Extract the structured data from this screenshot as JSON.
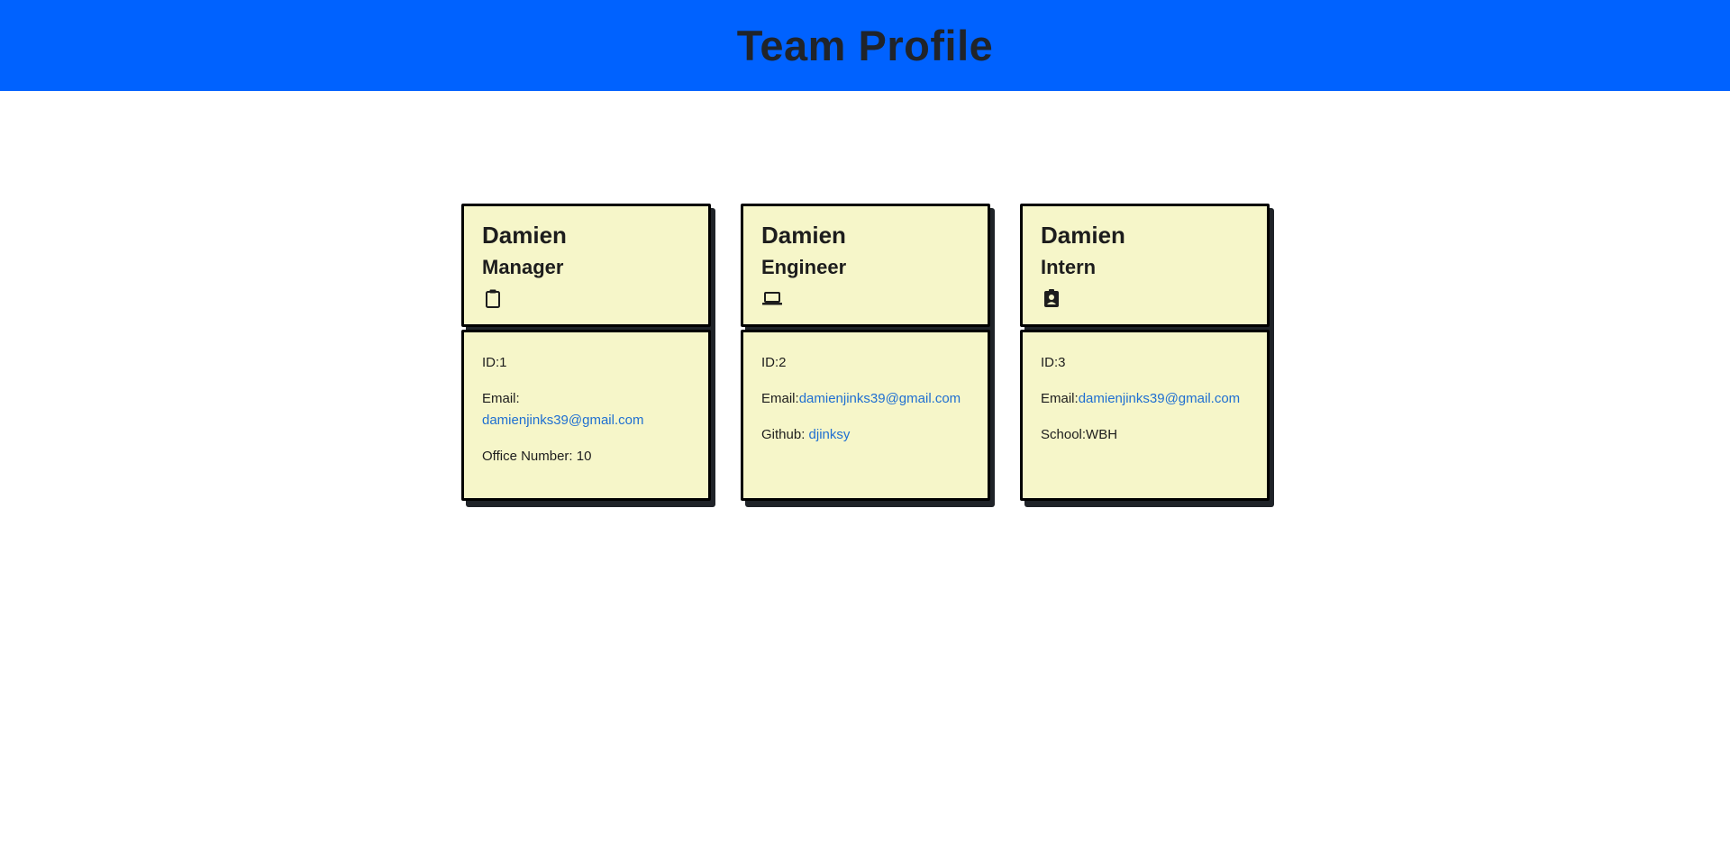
{
  "header": {
    "title": "Team Profile"
  },
  "members": [
    {
      "name": "Damien",
      "role": "Manager",
      "icon": "clipboard-icon",
      "id_label": "ID:1",
      "email_label": "Email:",
      "email": "damienjinks39@gmail.com",
      "extra_label": "Office Number: 10"
    },
    {
      "name": "Damien",
      "role": "Engineer",
      "icon": "laptop-icon",
      "id_label": "ID:2",
      "email_label": "Email:",
      "email": "damienjinks39@gmail.com",
      "github_label": "Github: ",
      "github": "djinksy"
    },
    {
      "name": "Damien",
      "role": "Intern",
      "icon": "user-badge-icon",
      "id_label": "ID:3",
      "email_label": "Email:",
      "email": "damienjinks39@gmail.com",
      "extra_label": "School:WBH"
    }
  ],
  "colors": {
    "header_bg": "#0062ff",
    "card_bg": "#f6f6c9",
    "link": "#1f6fd1"
  }
}
